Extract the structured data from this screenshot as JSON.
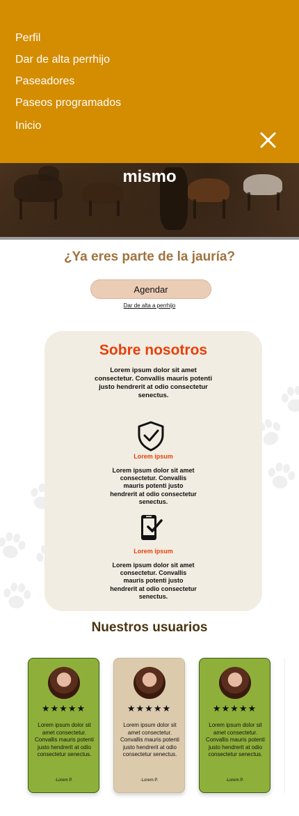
{
  "hero": {
    "title": "mismo"
  },
  "menu": {
    "items": [
      "Perfil",
      "Dar de alta perrhijo",
      "Paseadores",
      "Paseos programados",
      "Inicio"
    ],
    "close_icon": "close-icon"
  },
  "cta": {
    "question": "¿Ya eres parte de la jauría?",
    "button_label": "Agendar",
    "link_label": "Dar de alta a perrhijo"
  },
  "about": {
    "title": "Sobre nosotros",
    "text": "Lorem ipsum dolor sit amet consectetur. Convallis mauris potenti justo hendrerit at odio consectetur senectus.",
    "features": [
      {
        "icon": "shield-check-icon",
        "label": "Lorem ipsum",
        "text": "Lorem ipsum dolor sit amet consectetur. Convallis mauris potenti justo hendrerit at odio consectetur senectus."
      },
      {
        "icon": "phone-check-icon",
        "label": "Lorem ipsum",
        "text": "Lorem ipsum dolor sit amet consectetur. Convallis mauris potenti justo hendrerit at odio consectetur senectus."
      }
    ]
  },
  "users": {
    "title": "Nuestros usuarios",
    "cards": [
      {
        "stars": "★★★★★",
        "text": "Lorem ipsum dolor sit amet consectetur. Convallis mauris potenti justo hendrerit at odio consectetur senectus.",
        "author": "-Lorem P."
      },
      {
        "stars": "★★★★★",
        "text": "Lorem ipsum dolor sit amet consectetur. Convallis mauris potenti justo hendrerit at odio consectetur senectus.",
        "author": "-Lorem P."
      },
      {
        "stars": "★★★★★",
        "text": "Lorem ipsum dolor sit amet consectetur. Convallis mauris potenti justo hendrerit at odio consectetur senectus.",
        "author": "-Lorem P."
      }
    ]
  },
  "colors": {
    "menu_bg": "#d48c00",
    "accent_red": "#e8400c",
    "question_brown": "#a0733e",
    "card_green": "#8eb03a",
    "card_beige": "#dccaad",
    "about_bg": "#f1ede2"
  }
}
